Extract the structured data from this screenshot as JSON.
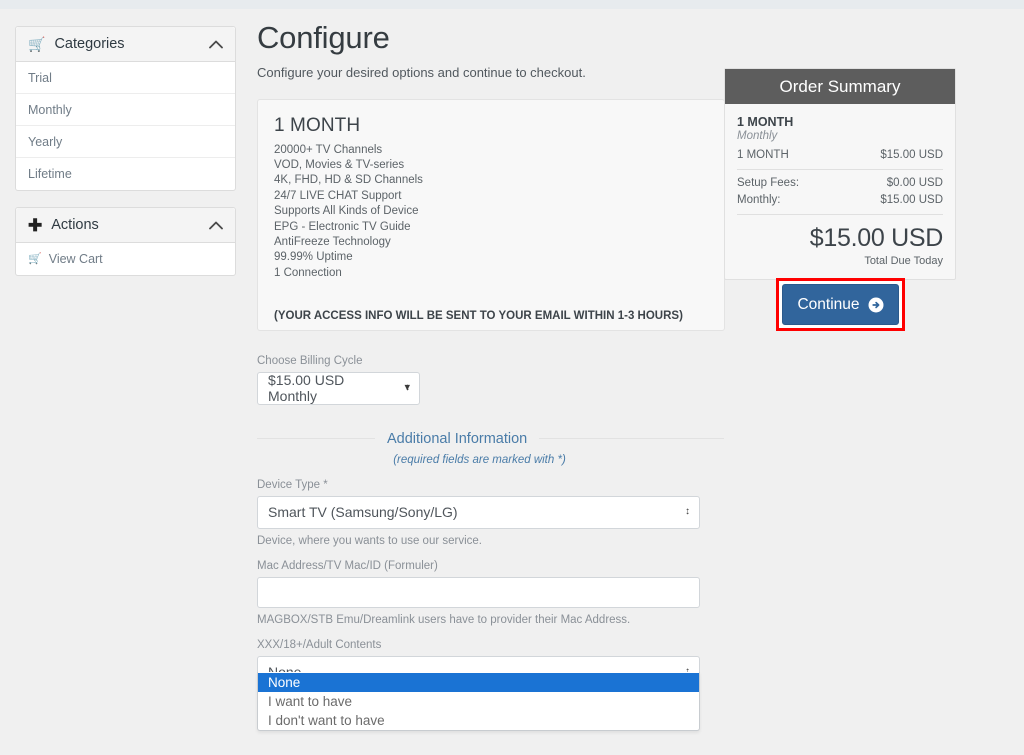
{
  "sidebar": {
    "panels": [
      {
        "title": "Categories",
        "icon": "cart-icon",
        "collapse_icon": "chevron-up-icon",
        "links": [
          {
            "label": "Trial"
          },
          {
            "label": "Monthly"
          },
          {
            "label": "Yearly"
          },
          {
            "label": "Lifetime"
          }
        ]
      },
      {
        "title": "Actions",
        "icon": "plus-icon",
        "collapse_icon": "chevron-up-icon",
        "links": [
          {
            "label": "View Cart",
            "icon": "cart-icon"
          }
        ]
      }
    ]
  },
  "page": {
    "title": "Configure",
    "subtitle": "Configure your desired options and continue to checkout."
  },
  "product": {
    "name": "1 MONTH",
    "features": [
      "20000+ TV Channels",
      "VOD, Movies & TV-series",
      "4K, FHD, HD & SD Channels",
      "24/7 LIVE CHAT Support",
      "Supports All Kinds of Device",
      "EPG - Electronic TV Guide",
      "AntiFreeze Technology",
      "99.99% Uptime",
      "1 Connection"
    ],
    "note": "(YOUR ACCESS INFO WILL BE SENT TO YOUR EMAIL WITHIN 1-3 HOURS)"
  },
  "billing": {
    "label": "Choose Billing Cycle",
    "selected": "$15.00 USD Monthly",
    "options": [
      "$15.00 USD Monthly"
    ]
  },
  "additional": {
    "legend": "Additional Information",
    "required_note": "(required fields are marked with *)",
    "device_type": {
      "label": "Device Type *",
      "selected": "Smart TV (Samsung/Sony/LG)",
      "help": "Device, where you wants to use our service."
    },
    "mac_address": {
      "label": "Mac Address/TV Mac/ID (Formuler)",
      "value": "",
      "placeholder": "",
      "help": "MAGBOX/STB Emu/Dreamlink users have to provider their Mac Address."
    },
    "adult_contents": {
      "label": "XXX/18+/Adult Contents",
      "selected": "None",
      "options": [
        "None",
        "I want to have",
        "I don't want to have"
      ],
      "highlighted": "None"
    }
  },
  "summary": {
    "header": "Order Summary",
    "product_name": "1 MONTH",
    "cycle": "Monthly",
    "line_item_label": "1 MONTH",
    "line_item_price": "$15.00 USD",
    "setup_fees_label": "Setup Fees:",
    "setup_fees_value": "$0.00 USD",
    "monthly_label": "Monthly:",
    "monthly_value": "$15.00 USD",
    "total": "$15.00 USD",
    "total_label": "Total Due Today"
  },
  "cta": {
    "label": "Continue",
    "icon": "arrow-circle-right-icon",
    "color": "#31659c",
    "annotation_color": "#ff0000"
  },
  "colors": {
    "page_background": "#f0f0f0",
    "top_strip": "#e7ebee",
    "summary_header": "#5d5d5d",
    "dropdown_highlight": "#1a73d4",
    "legend_text": "#4a7ca8"
  }
}
